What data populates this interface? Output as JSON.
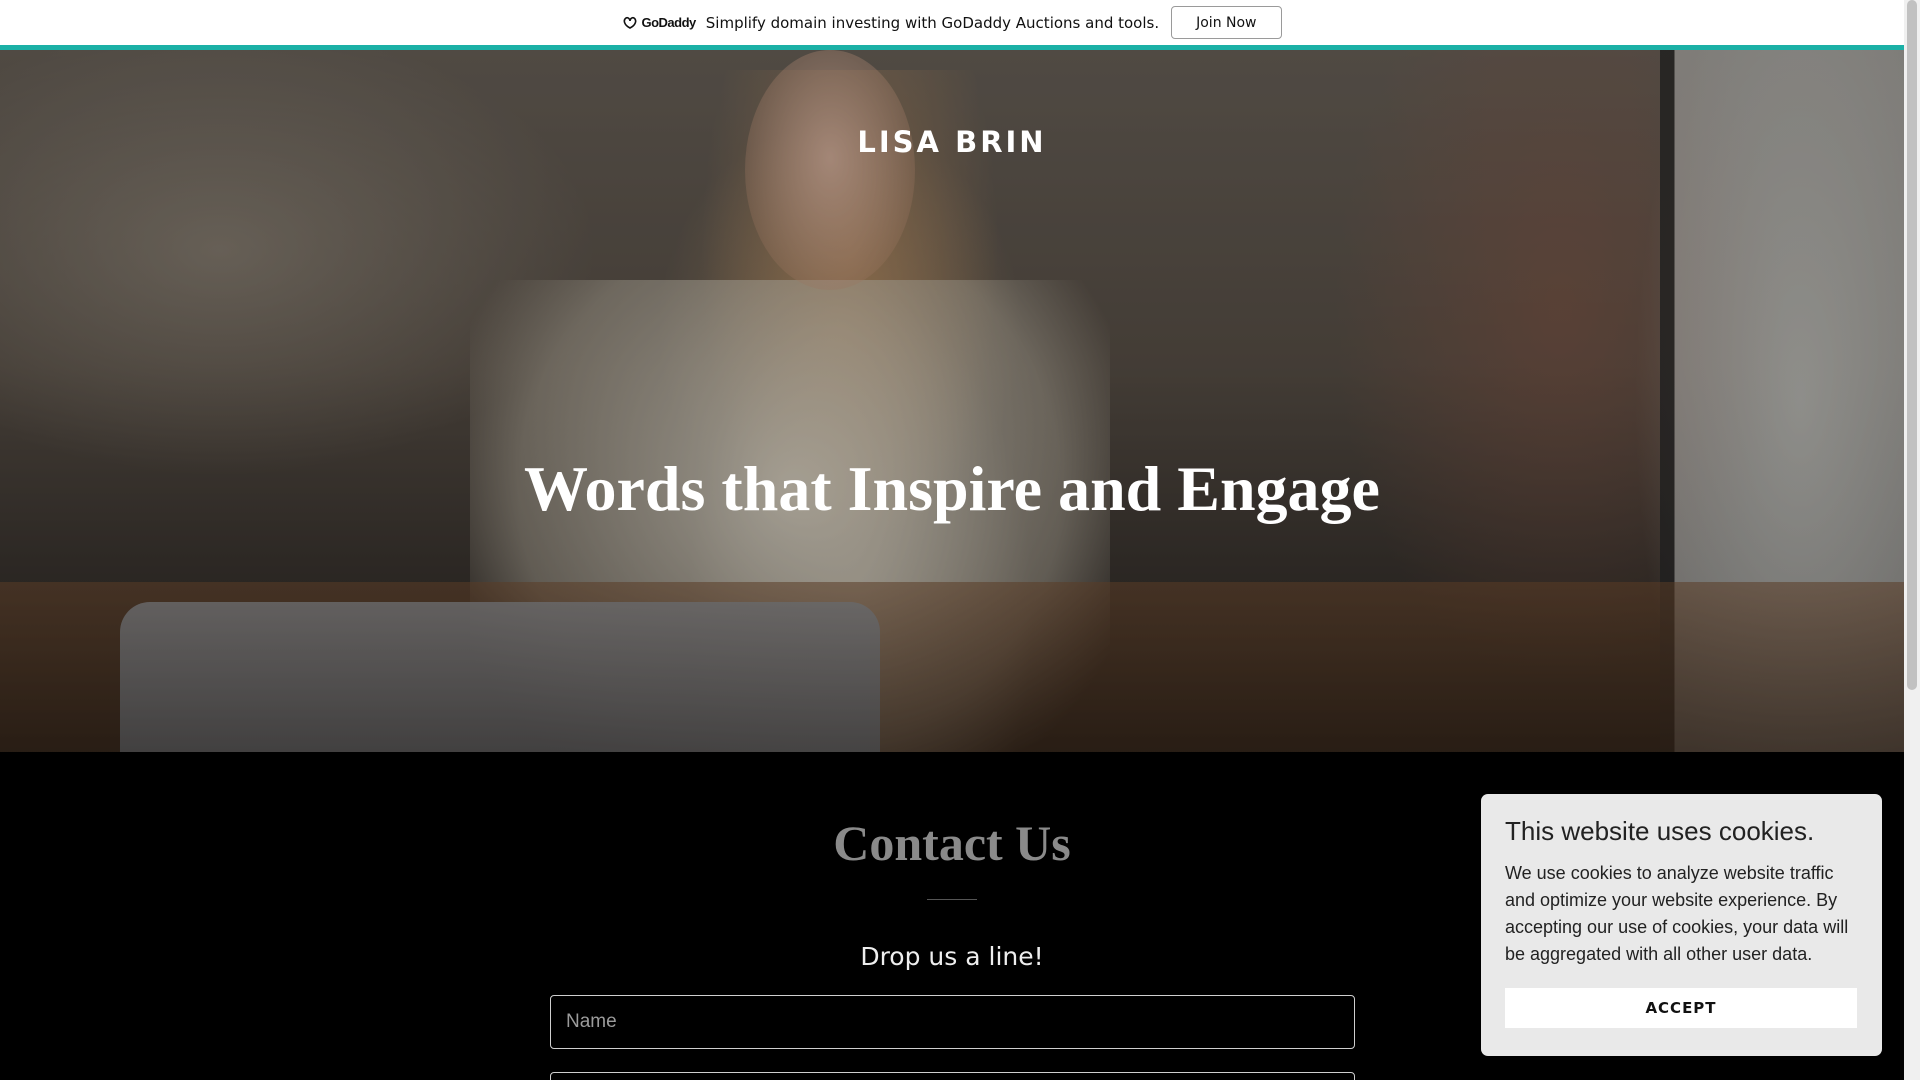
{
  "promo": {
    "logo_text": "GoDaddy",
    "message": "Simplify domain investing with GoDaddy Auctions and tools.",
    "join_label": "Join Now",
    "accent_color": "#1bb0a6"
  },
  "hero": {
    "site_title": "LISA BRIN",
    "heading": "Words that Inspire and Engage"
  },
  "contact": {
    "title": "Contact Us",
    "subtitle": "Drop us a line!",
    "name_placeholder": "Name"
  },
  "cookie_banner": {
    "title": "This website uses cookies.",
    "text": "We use cookies to analyze website traffic and optimize your website experience. By accepting our use of cookies, your data will be aggregated with all other user data.",
    "accept_label": "ACCEPT"
  },
  "icons": {
    "logo": "godaddy-logo-icon"
  }
}
